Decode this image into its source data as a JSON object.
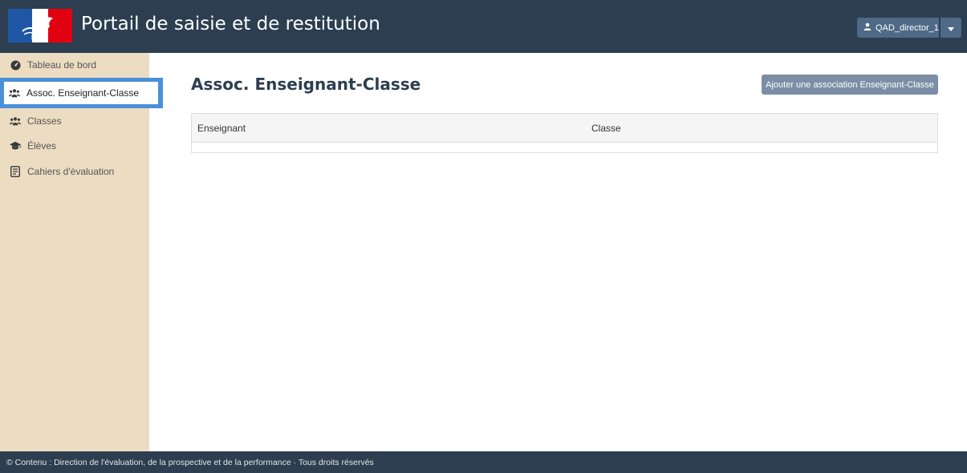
{
  "header": {
    "title": "Portail de saisie et de restitution",
    "logo_icon": "marianne-logo",
    "user": {
      "name": "QAD_director_1",
      "icon": "user-icon",
      "caret_icon": "caret-down-icon"
    }
  },
  "sidebar": {
    "items": [
      {
        "label": "Tableau de bord",
        "icon": "dashboard-icon",
        "active": false
      },
      {
        "label": "Assoc. Enseignant-Classe",
        "icon": "users-icon",
        "active": true
      },
      {
        "label": "Classes",
        "icon": "users-icon",
        "active": false
      },
      {
        "label": "Élèves",
        "icon": "graduation-cap-icon",
        "active": false
      },
      {
        "label": "Cahiers d'évaluation",
        "icon": "notebook-icon",
        "active": false
      }
    ]
  },
  "main": {
    "title": "Assoc. Enseignant-Classe",
    "add_button_label": "Ajouter une association Enseignant-Classe",
    "table": {
      "columns": [
        "Enseignant",
        "Classe"
      ],
      "rows": []
    }
  },
  "footer": {
    "text": "© Contenu : Direction de l'évaluation, de la prospective et de la performance · Tous droits réservés"
  },
  "colors": {
    "header_bg": "#2c3e50",
    "sidebar_bg": "#ebdcc2",
    "active_highlight": "#4a90d9",
    "button_bg": "#7b8ea6"
  }
}
